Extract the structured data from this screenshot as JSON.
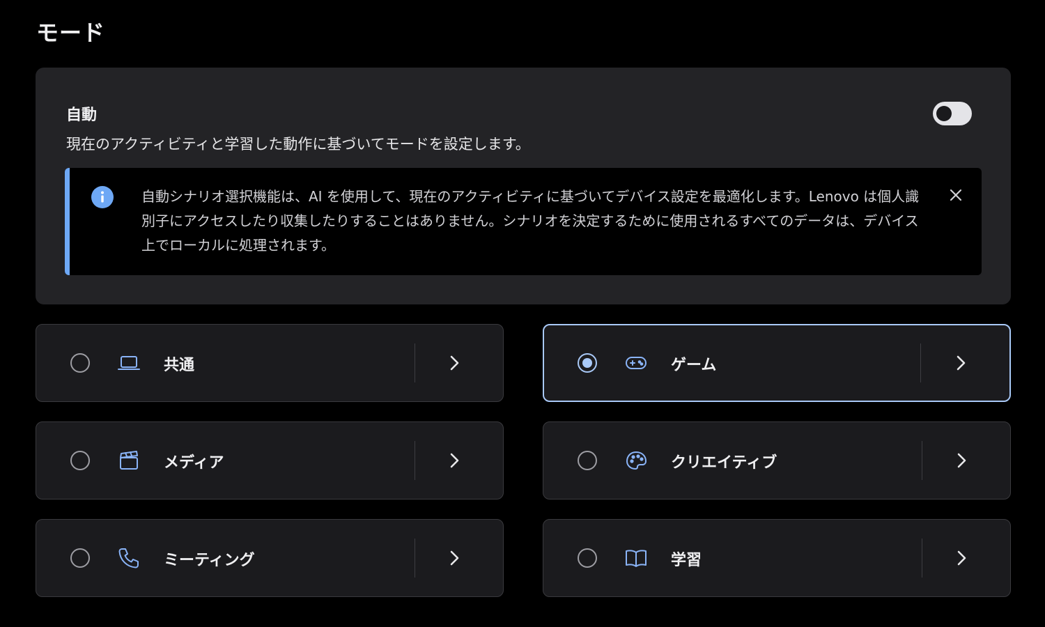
{
  "page": {
    "title": "モード"
  },
  "auto": {
    "title": "自動",
    "description": "現在のアクティビティと学習した動作に基づいてモードを設定します。",
    "toggle_on": false,
    "info": {
      "text": "自動シナリオ選択機能は、AI を使用して、現在のアクティビティに基づいてデバイス設定を最適化します。Lenovo は個人識別子にアクセスしたり収集したりすることはありません。シナリオを決定するために使用されるすべてのデータは、デバイス上でローカルに処理されます。",
      "icon": "info-icon",
      "close_icon": "close-icon"
    }
  },
  "modes": [
    {
      "label": "共通",
      "icon": "laptop-icon",
      "selected": false
    },
    {
      "label": "ゲーム",
      "icon": "gamepad-icon",
      "selected": true
    },
    {
      "label": "メディア",
      "icon": "clapperboard-icon",
      "selected": false
    },
    {
      "label": "クリエイティブ",
      "icon": "palette-icon",
      "selected": false
    },
    {
      "label": "ミーティング",
      "icon": "phone-icon",
      "selected": false
    },
    {
      "label": "学習",
      "icon": "book-icon",
      "selected": false
    }
  ],
  "colors": {
    "accent": "#a9c9f7",
    "info_accent": "#6ea8f5",
    "card_bg": "#1b1b1e",
    "panel_bg": "#232326",
    "icon": "#8ab4f8"
  }
}
